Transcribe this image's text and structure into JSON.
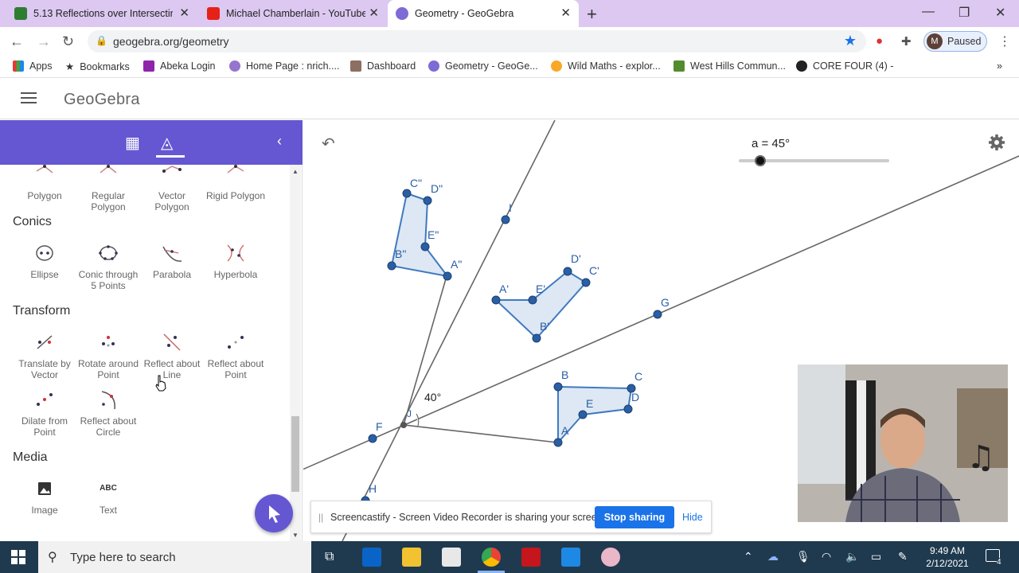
{
  "browser": {
    "tabs": [
      {
        "title": "5.13 Reflections over Intersecting",
        "active": false,
        "icon": "classroom-icon"
      },
      {
        "title": "Michael Chamberlain - YouTube",
        "active": false,
        "icon": "youtube-icon"
      },
      {
        "title": "Geometry - GeoGebra",
        "active": true,
        "icon": "geogebra-icon"
      }
    ],
    "url": "geogebra.org/geometry",
    "profile_initial": "M",
    "profile_status": "Paused",
    "bookmarks": [
      "Apps",
      "Bookmarks",
      "Abeka Login",
      "Home Page : nrich....",
      "Dashboard",
      "Geometry - GeoGe...",
      "Wild Maths - explor...",
      "West Hills Commun...",
      "CORE FOUR (4) -"
    ],
    "more_bookmarks": "»"
  },
  "geogebra": {
    "logo": "GeoGebra",
    "tools": {
      "top_row": [
        "Polygon",
        "Regular Polygon",
        "Vector Polygon",
        "Rigid Polygon"
      ],
      "sections": [
        {
          "title": "Conics",
          "items": [
            "Ellipse",
            "Conic through 5 Points",
            "Parabola",
            "Hyperbola"
          ]
        },
        {
          "title": "Transform",
          "items": [
            "Translate by Vector",
            "Rotate around Point",
            "Reflect about Line",
            "Reflect about Point",
            "Dilate from Point",
            "Reflect about Circle"
          ]
        },
        {
          "title": "Media",
          "items": [
            "Image",
            "Text"
          ]
        }
      ],
      "text_tool_glyph": "ABC"
    },
    "slider": {
      "label": "a = 45°",
      "value": 45
    },
    "angle_label": "40°",
    "points": {
      "original": [
        "A",
        "B",
        "C",
        "D",
        "E"
      ],
      "first_image": [
        "A'",
        "B'",
        "C'",
        "D'",
        "E'"
      ],
      "second_image": [
        "A\"",
        "B\"",
        "C\"",
        "D\"",
        "E\""
      ],
      "lines": [
        "F",
        "G",
        "H",
        "I",
        "J"
      ]
    }
  },
  "screencastify": {
    "message": "Screencastify - Screen Video Recorder is sharing your screen.",
    "stop_label": "Stop sharing",
    "hide_label": "Hide"
  },
  "taskbar": {
    "search_placeholder": "Type here to search",
    "time": "9:49 AM",
    "date": "2/12/2021",
    "notifications": "4"
  }
}
